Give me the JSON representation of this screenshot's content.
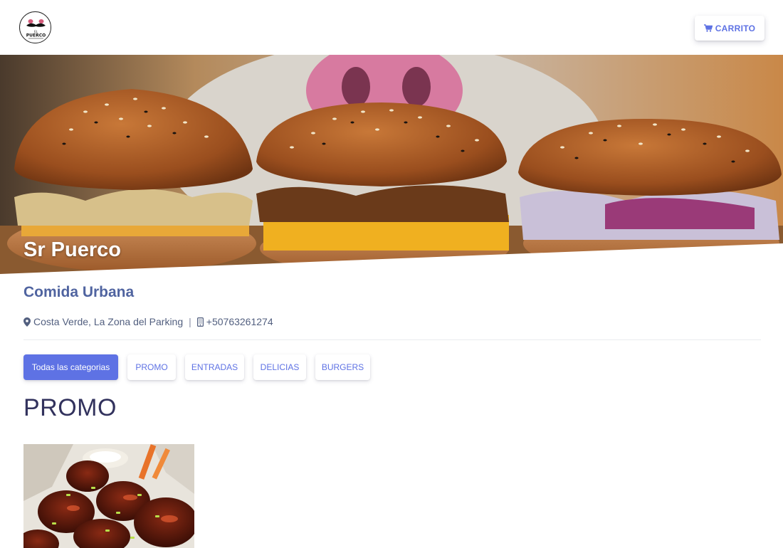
{
  "header": {
    "logo_text": "PUERCO",
    "cart_label": "CARRITO"
  },
  "hero": {
    "title": "Sr Puerco"
  },
  "restaurant": {
    "category": "Comida Urbana",
    "address": "Costa Verde, La Zona del Parking",
    "separator": "|",
    "phone": "+50763261274"
  },
  "categories": {
    "items": [
      "Todas las categorias",
      "PROMO",
      "ENTRADAS",
      "DELICIAS",
      "BURGERS"
    ],
    "active": "Todas las categorias"
  },
  "section": {
    "title": "PROMO"
  },
  "colors": {
    "accent": "#5e72e4",
    "heading": "#32325d",
    "subtitle": "#5064a0"
  },
  "icons": {
    "cart": "shopping-cart-icon",
    "address": "map-marker-icon",
    "phone": "mobile-phone-icon"
  }
}
